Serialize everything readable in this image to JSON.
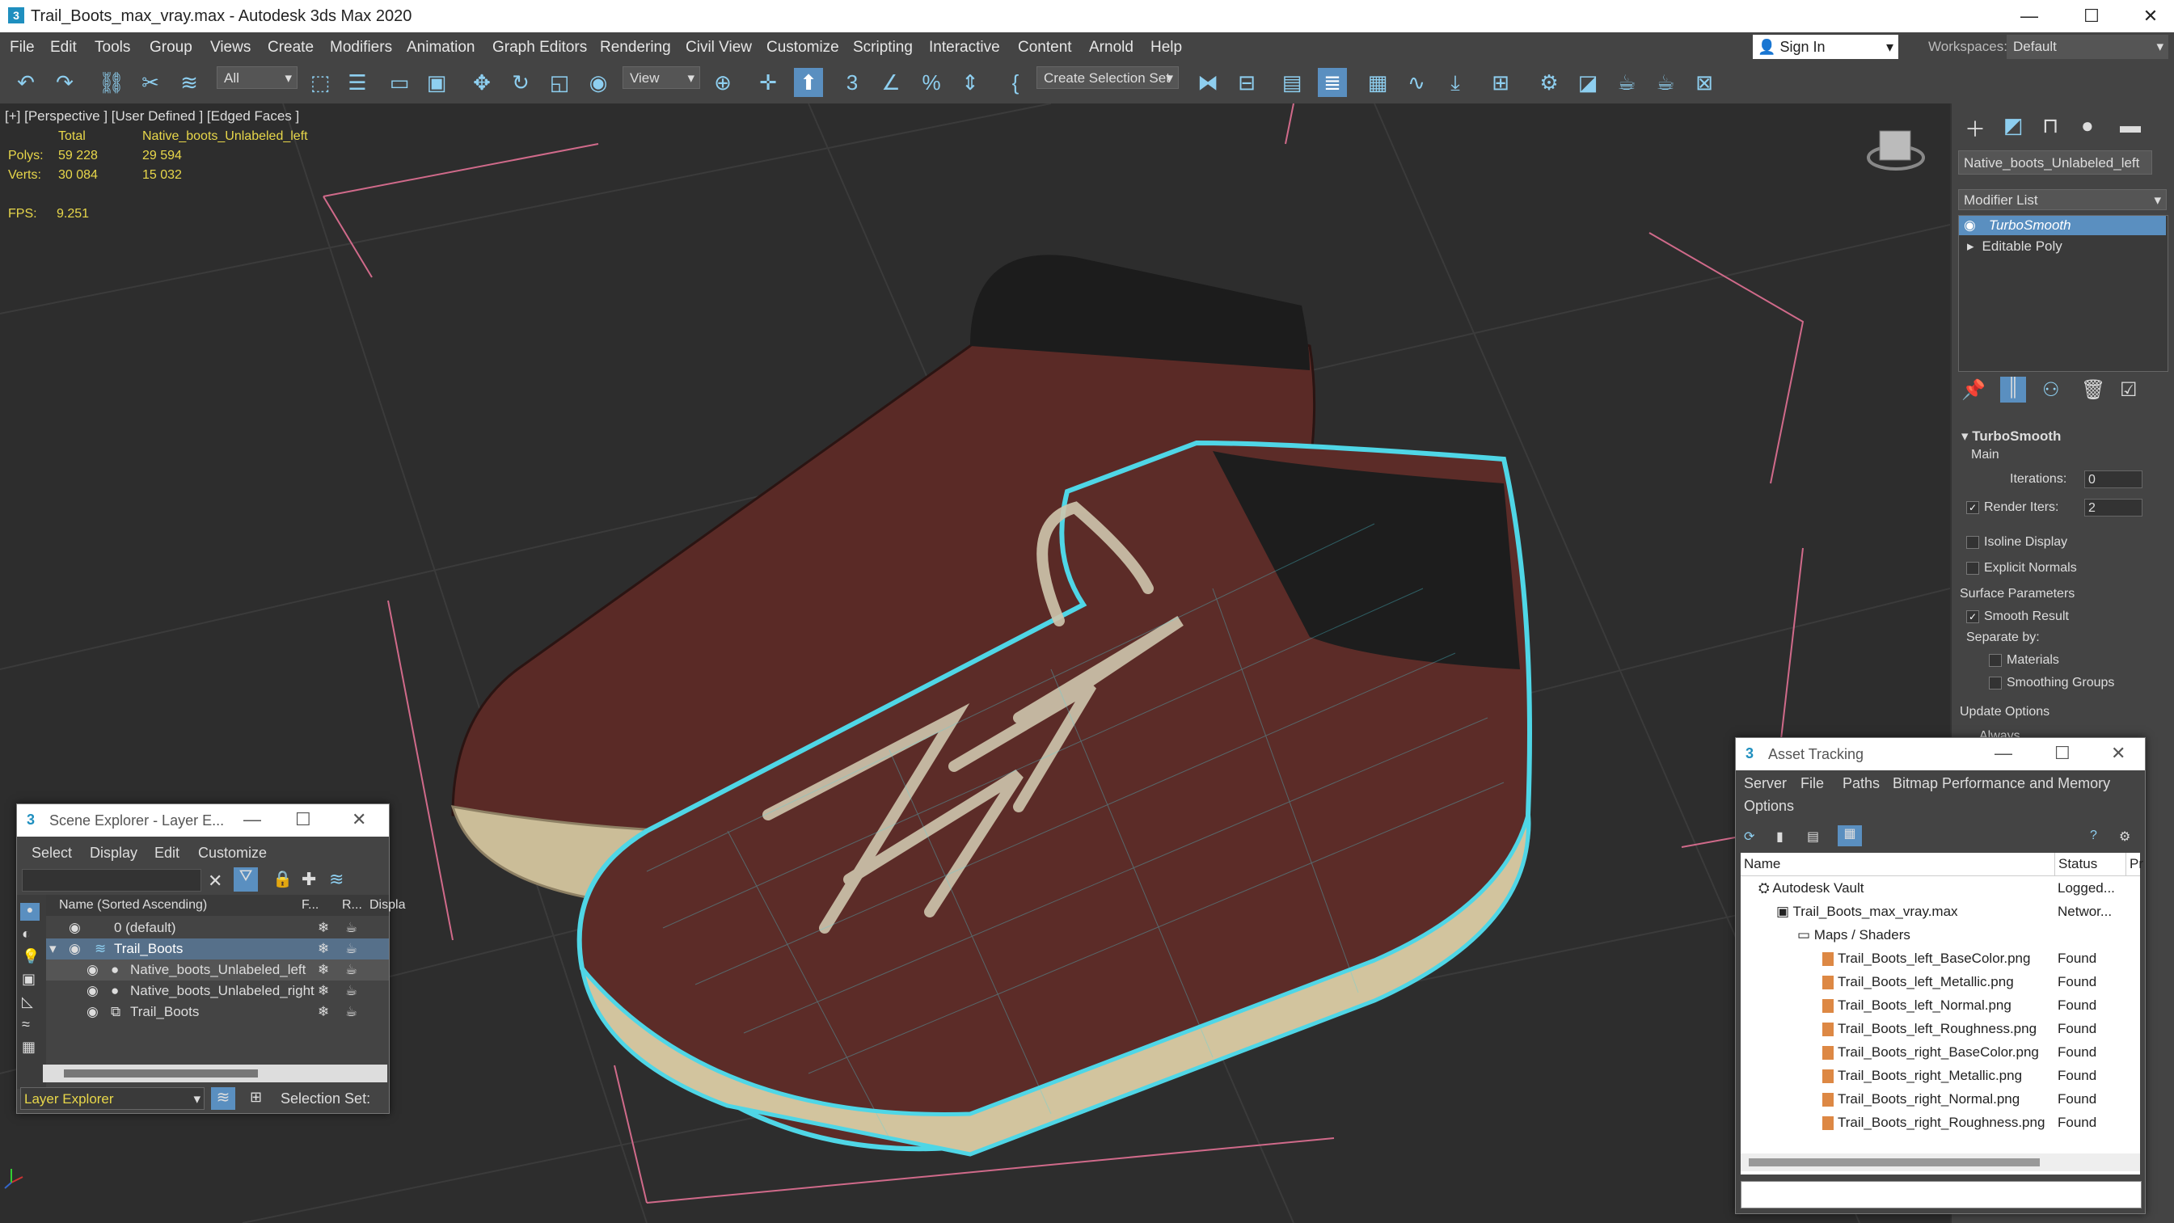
{
  "window": {
    "title": "Trail_Boots_max_vray.max - Autodesk 3ds Max 2020",
    "minimize": "—",
    "maximize": "☐",
    "close": "✕"
  },
  "menu": [
    "File",
    "Edit",
    "Tools",
    "Group",
    "Views",
    "Create",
    "Modifiers",
    "Animation",
    "Graph Editors",
    "Rendering",
    "Civil View",
    "Customize",
    "Scripting",
    "Interactive",
    "Content",
    "Arnold",
    "Help"
  ],
  "account": {
    "sign_in": "Sign In",
    "workspaces_label": "Workspaces:",
    "workspace_value": "Default"
  },
  "toolbar": {
    "filter": "All",
    "view": "View",
    "selection_set": "Create Selection Set"
  },
  "viewport": {
    "label": "[+] [Perspective ] [User Defined ] [Edged Faces ]",
    "stats": {
      "total_label": "Total",
      "object_label": "Native_boots_Unlabeled_left",
      "polys_label": "Polys:",
      "polys_total": "59 228",
      "polys_obj": "29 594",
      "verts_label": "Verts:",
      "verts_total": "30 084",
      "verts_obj": "15 032",
      "fps_label": "FPS:",
      "fps_value": "9.251"
    }
  },
  "command_panel": {
    "object_name": "Native_boots_Unlabeled_left",
    "modifier_list": "Modifier List",
    "stack": [
      "TurboSmooth",
      "Editable Poly"
    ],
    "rollout_title": "TurboSmooth",
    "main": "Main",
    "iterations_label": "Iterations:",
    "iterations_value": "0",
    "render_iters_label": "Render Iters:",
    "render_iters_value": "2",
    "isoline": "Isoline Display",
    "explicit_normals": "Explicit Normals",
    "surface_params": "Surface Parameters",
    "smooth_result": "Smooth Result",
    "separate_by": "Separate by:",
    "materials": "Materials",
    "smoothing_groups": "Smoothing Groups",
    "update_options": "Update Options",
    "always": "Always"
  },
  "scene_explorer": {
    "title": "Scene Explorer - Layer E...",
    "menu": [
      "Select",
      "Display",
      "Edit",
      "Customize"
    ],
    "col_name": "Name (Sorted Ascending)",
    "col_f": "F...",
    "col_r": "R...",
    "col_display": "Displa",
    "rows": [
      {
        "name": "0 (default)"
      },
      {
        "name": "Trail_Boots"
      },
      {
        "name": "Native_boots_Unlabeled_left"
      },
      {
        "name": "Native_boots_Unlabeled_right"
      },
      {
        "name": "Trail_Boots"
      }
    ],
    "explorer_type": "Layer Explorer",
    "selection_set": "Selection Set:"
  },
  "asset_tracking": {
    "title": "Asset Tracking",
    "menu": [
      "Server",
      "File",
      "Paths",
      "Bitmap Performance and Memory",
      "Options"
    ],
    "col_name": "Name",
    "col_status": "Status",
    "col_p": "Pr",
    "rows": [
      {
        "name": "Autodesk Vault",
        "status": "Logged..."
      },
      {
        "name": "Trail_Boots_max_vray.max",
        "status": "Networ..."
      },
      {
        "name": "Maps / Shaders",
        "status": ""
      },
      {
        "name": "Trail_Boots_left_BaseColor.png",
        "status": "Found"
      },
      {
        "name": "Trail_Boots_left_Metallic.png",
        "status": "Found"
      },
      {
        "name": "Trail_Boots_left_Normal.png",
        "status": "Found"
      },
      {
        "name": "Trail_Boots_left_Roughness.png",
        "status": "Found"
      },
      {
        "name": "Trail_Boots_right_BaseColor.png",
        "status": "Found"
      },
      {
        "name": "Trail_Boots_right_Metallic.png",
        "status": "Found"
      },
      {
        "name": "Trail_Boots_right_Normal.png",
        "status": "Found"
      },
      {
        "name": "Trail_Boots_right_Roughness.png",
        "status": "Found"
      }
    ]
  }
}
